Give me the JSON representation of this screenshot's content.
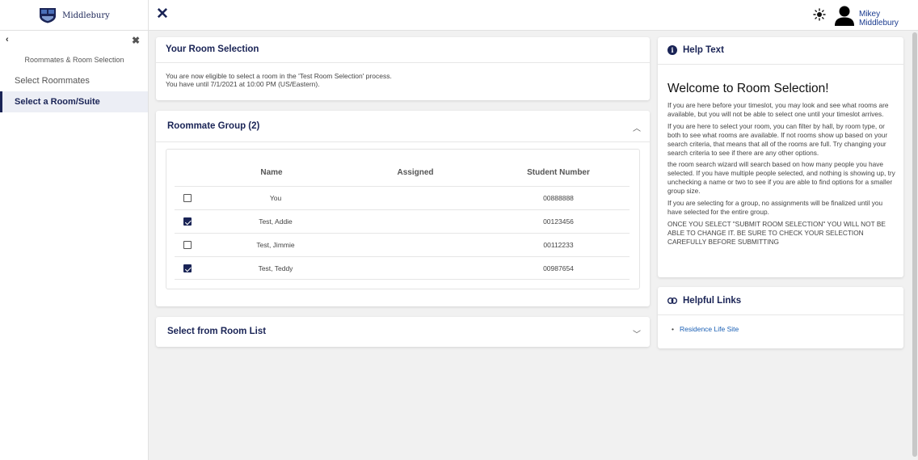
{
  "brand": {
    "name": "Middlebury"
  },
  "user": {
    "name": "Mikey Middlebury"
  },
  "sidebar": {
    "back_glyph": "‹",
    "close_glyph": "✖",
    "title": "Roommates & Room Selection",
    "items": [
      {
        "label": "Select Roommates",
        "active": false
      },
      {
        "label": "Select a Room/Suite",
        "active": true
      }
    ]
  },
  "selection": {
    "title": "Your Room Selection",
    "line1": "You are now eligible to select a room in the 'Test Room Selection' process.",
    "line2": "You have until 7/1/2021 at 10:00 PM (US/Eastern)."
  },
  "group": {
    "title": "Roommate Group (2)",
    "columns": {
      "name": "Name",
      "assigned": "Assigned",
      "number": "Student Number"
    },
    "rows": [
      {
        "name": "You",
        "assigned": "",
        "number": "00888888",
        "checked": false
      },
      {
        "name": "Test, Addie",
        "assigned": "",
        "number": "00123456",
        "checked": true
      },
      {
        "name": "Test, Jimmie",
        "assigned": "",
        "number": "00112233",
        "checked": false
      },
      {
        "name": "Test, Teddy",
        "assigned": "",
        "number": "00987654",
        "checked": true
      }
    ]
  },
  "room_list": {
    "title": "Select from Room List"
  },
  "help": {
    "title": "Help Text",
    "welcome": "Welcome to Room Selection!",
    "paragraphs": [
      "If you are here before your timeslot, you may look and see what rooms are available, but you will not be able to select one until your timeslot arrives.",
      "If you are here to select your room, you can filter by hall, by room type, or both to see what rooms are available. If not rooms show up based on your search criteria, that means that all of the rooms are full. Try changing your search criteria to see if there are any other options.",
      "the room search wizard will search based on how many people you have selected. If you have multiple people selected, and nothing is showing up, try unchecking a name or two to see if you are able to find options for a smaller group size.",
      "If you are selecting for a group, no assignments will be finalized until you have selected for the entire group.",
      "ONCE YOU SELECT \"SUBMIT ROOM SELECTION\" YOU WILL NOT BE ABLE TO CHANGE IT. BE SURE TO CHECK YOUR SELECTION CAREFULLY BEFORE SUBMITTING"
    ]
  },
  "links": {
    "title": "Helpful Links",
    "items": [
      "Residence Life Site"
    ]
  },
  "colors": {
    "navy": "#1a2456",
    "link": "#1a5fb4"
  }
}
